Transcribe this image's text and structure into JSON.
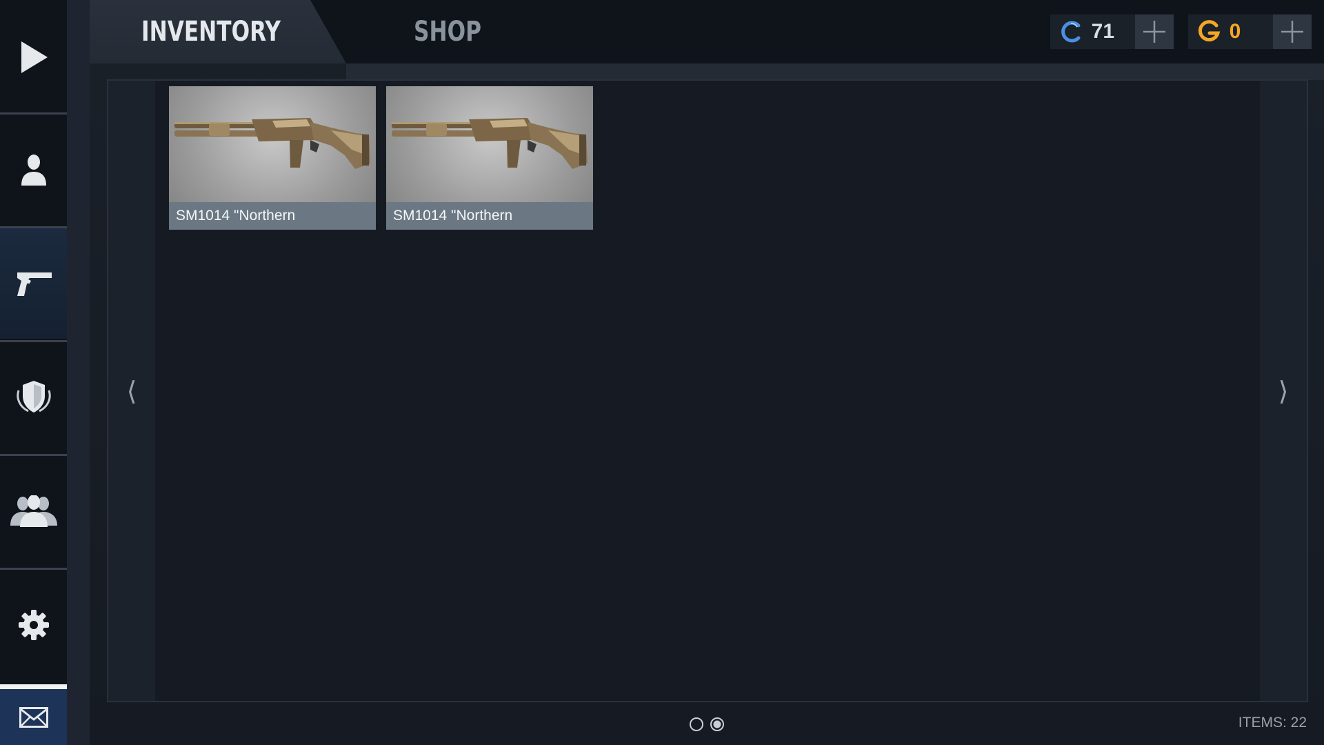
{
  "sidebar": {
    "items": [
      {
        "name": "play",
        "icon": "play-icon"
      },
      {
        "name": "profile",
        "icon": "user-icon"
      },
      {
        "name": "inventory",
        "icon": "pistol-icon",
        "active": true
      },
      {
        "name": "clan",
        "icon": "shield-icon"
      },
      {
        "name": "friends",
        "icon": "friends-icon"
      },
      {
        "name": "settings",
        "icon": "gear-icon"
      },
      {
        "name": "mail",
        "icon": "mail-icon"
      }
    ]
  },
  "tabs": {
    "inventory": "INVENTORY",
    "shop": "SHOP",
    "active": "inventory"
  },
  "currency": {
    "credits": {
      "icon": "credits-c-icon",
      "value": "71",
      "color": "#4a90e2"
    },
    "gold": {
      "icon": "gold-g-icon",
      "value": "0",
      "color": "#f5a623"
    }
  },
  "inventory": {
    "cards": [
      {
        "label": "SM1014 \"Northern",
        "icon": "shotgun-image"
      },
      {
        "label": "SM1014 \"Northern",
        "icon": "shotgun-image"
      }
    ],
    "pager": {
      "pages": 2,
      "current": 2
    },
    "items_count": "ITEMS: 22"
  },
  "colors": {
    "background": "#161b23",
    "active_sidebar": "#1b2a3e",
    "mail_button": "#1d3357",
    "card_label": "#6b7884"
  }
}
